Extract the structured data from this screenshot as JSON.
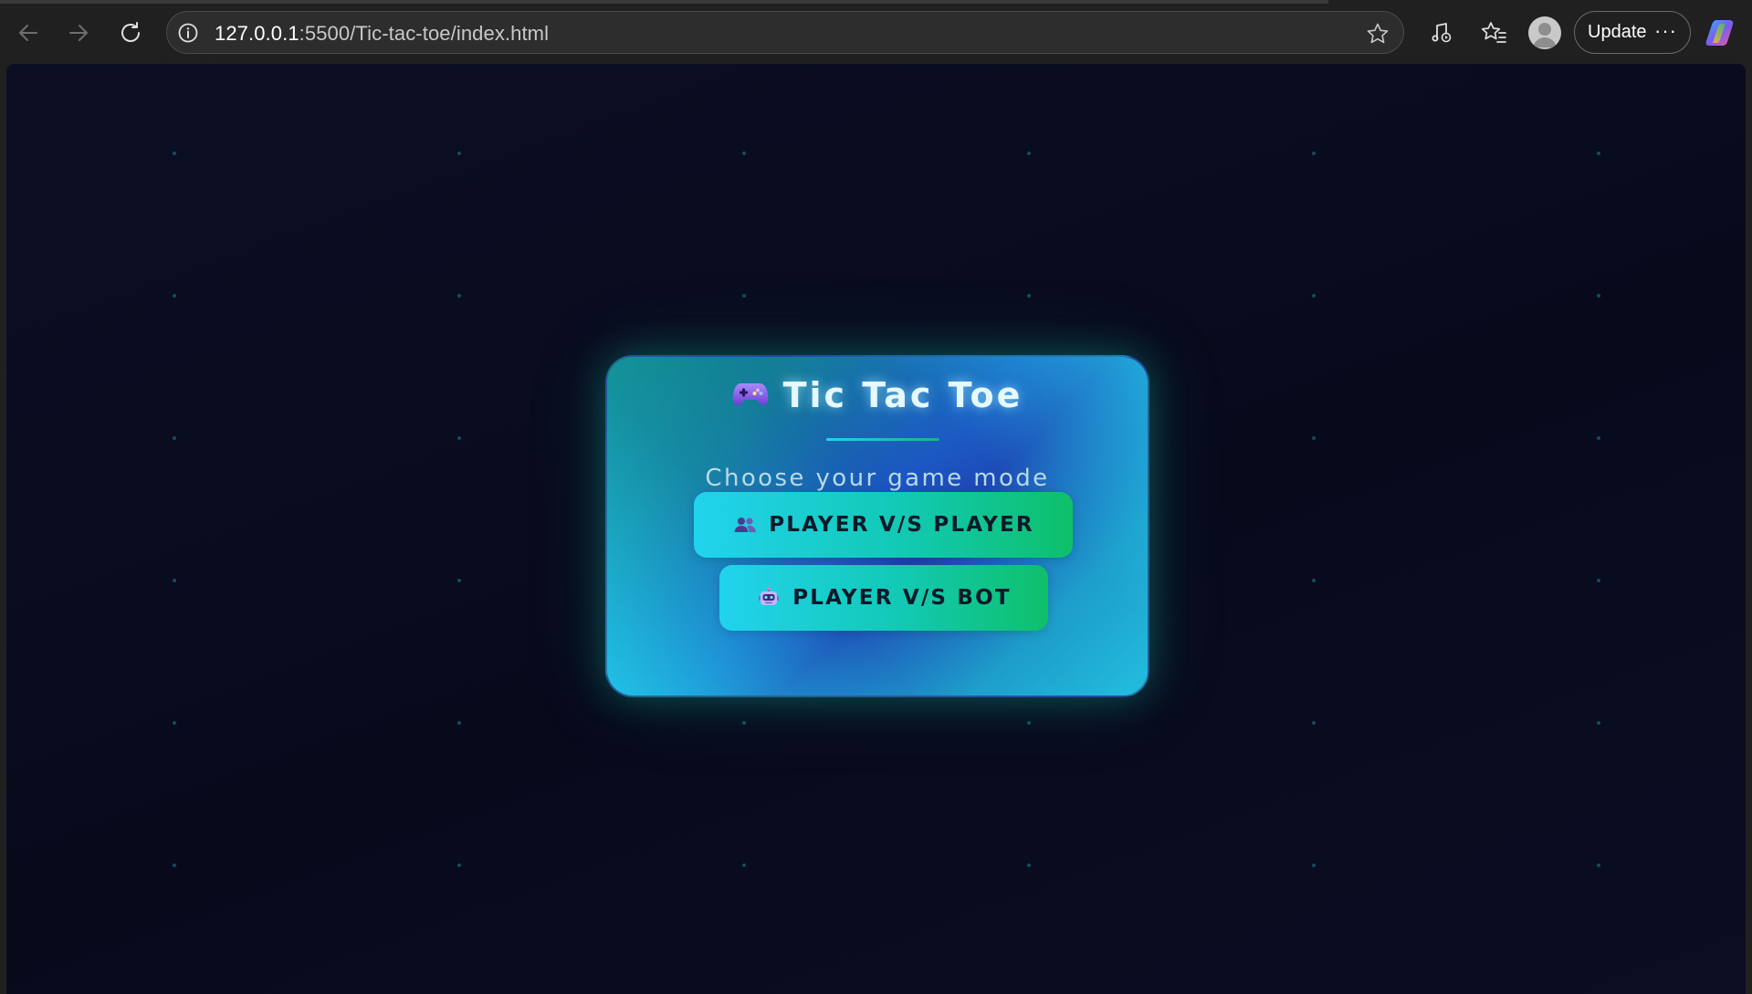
{
  "browser": {
    "url_host": "127.0.0.1",
    "url_rest": ":5500/Tic-tac-toe/index.html",
    "update_label": "Update",
    "more_label": "···"
  },
  "icons": {
    "back": "back-arrow-icon",
    "forward": "forward-arrow-icon",
    "reload": "reload-icon",
    "info": "site-info-icon",
    "favorite": "star-icon",
    "media": "media-control-icon",
    "favorites": "favorites-icon",
    "profile": "profile-avatar-icon",
    "copilot": "copilot-icon",
    "gamepad": "gamepad-icon",
    "players": "two-players-icon",
    "robot": "robot-icon"
  },
  "game": {
    "title": "Tic Tac Toe",
    "subtitle": "Choose your game mode",
    "buttons": {
      "pvp": "PLAYER V/S PLAYER",
      "pvb": "PLAYER V/S BOT"
    }
  },
  "colors": {
    "page_bg": "#090b1e",
    "accent_cyan": "#22d3ee",
    "accent_green": "#10b981",
    "card_blue": "#1d3ab0"
  }
}
